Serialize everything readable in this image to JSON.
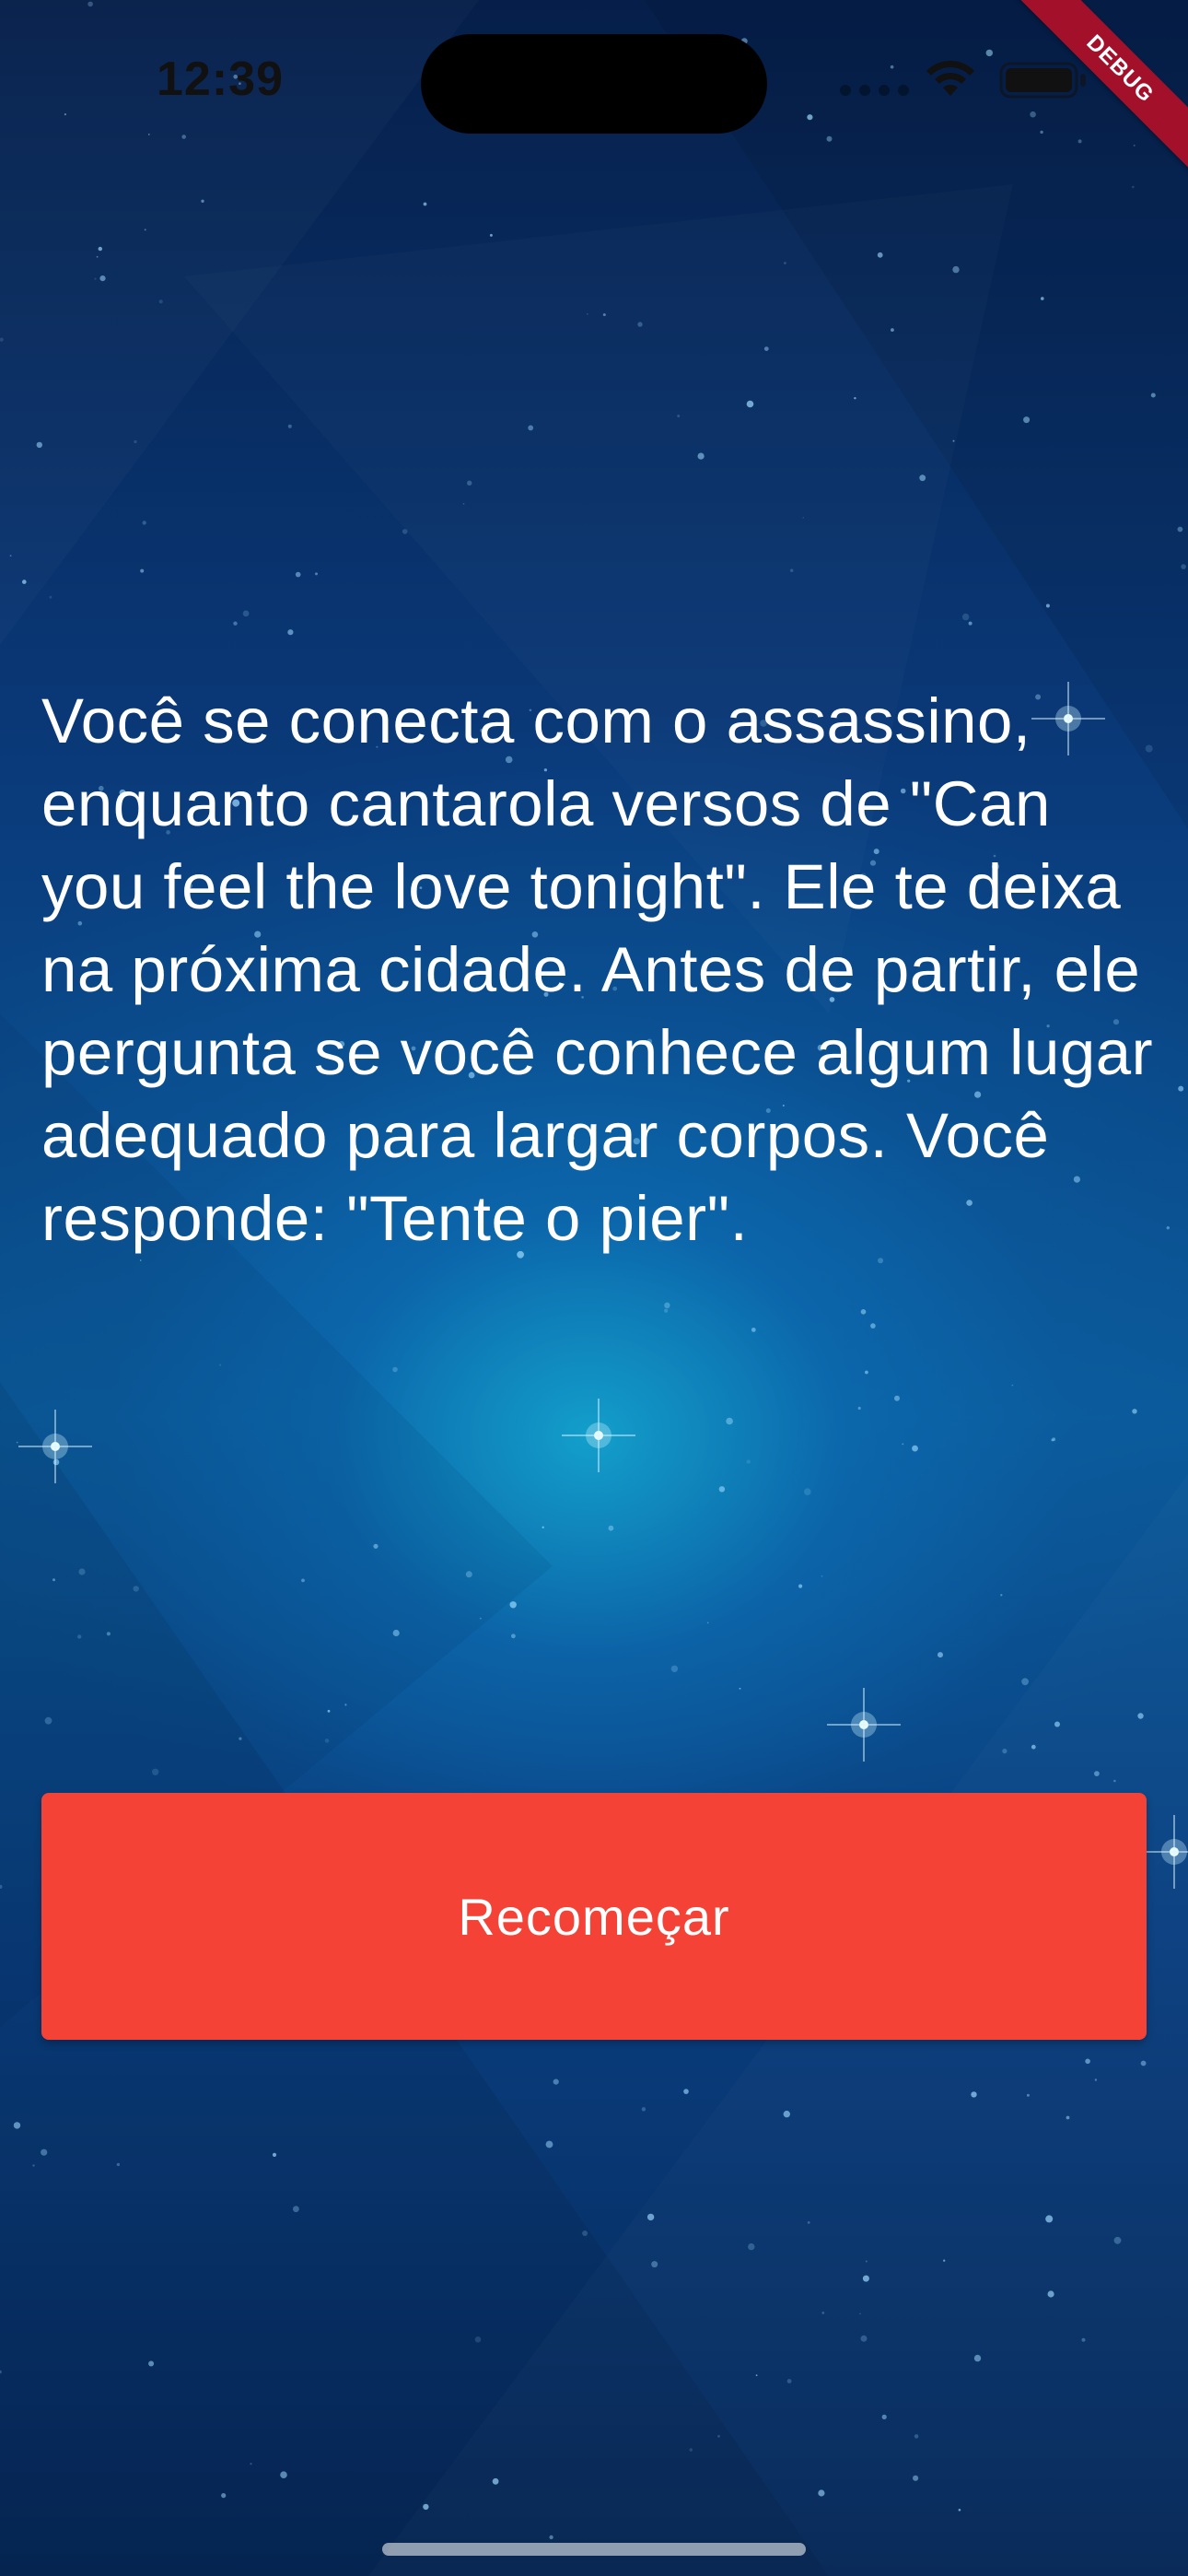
{
  "status_bar": {
    "time": "12:39",
    "debug_label": "DEBUG"
  },
  "story": {
    "text": "Você se conecta com o assassino, enquanto cantarola versos de \"Can you feel the love tonight\". Ele te deixa na próxima cidade. Antes de partir, ele pergunta se você conhece algum lugar adequado para largar corpos. Você responde: \"Tente o pier\"."
  },
  "actions": {
    "restart_label": "Recomeçar"
  },
  "icons": {
    "wifi": "wifi-icon",
    "battery": "battery-icon"
  },
  "colors": {
    "button": "#f44336",
    "text": "#ffffff",
    "debug_ribbon": "#a3102a"
  }
}
